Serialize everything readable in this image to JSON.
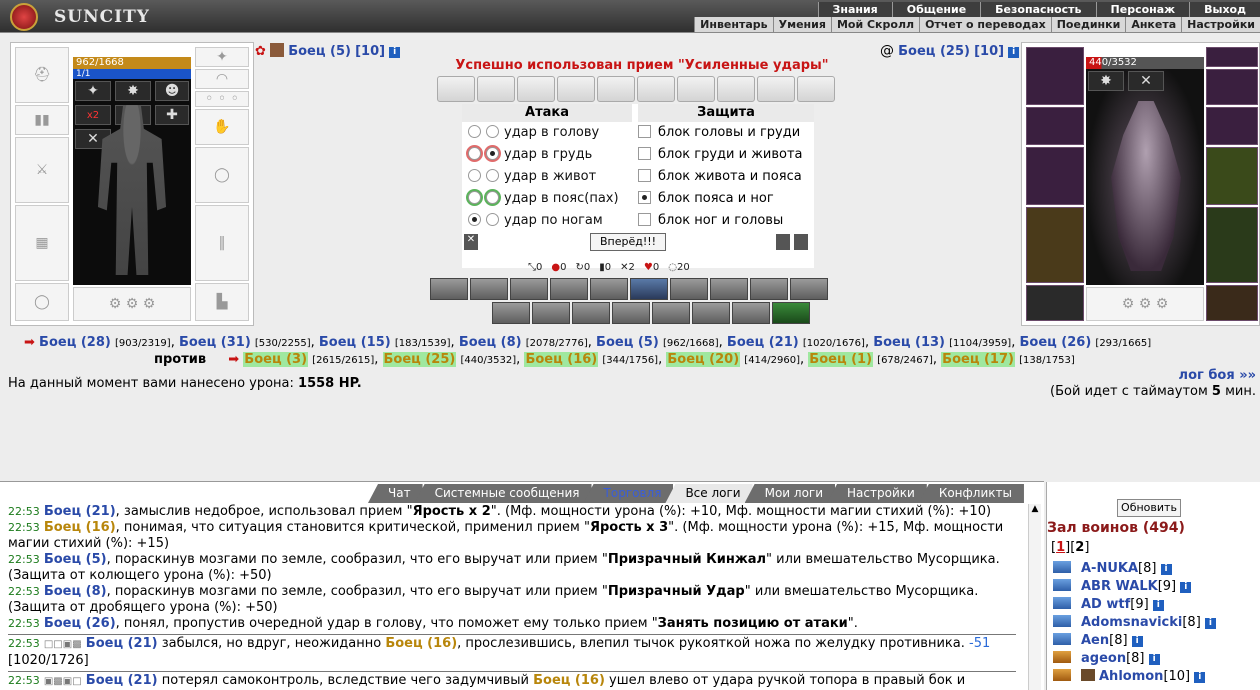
{
  "app": {
    "name": "SUNCITY"
  },
  "menu_top": [
    "Знания",
    "Общение",
    "Безопасность",
    "Персонаж",
    "Выход"
  ],
  "menu_sub": [
    "Инвентарь",
    "Умения",
    "Мой Скролл",
    "Отчет о переводах",
    "Поединки",
    "Анкета",
    "Настройки"
  ],
  "left_fighter": {
    "name": "Боец (5)",
    "level": "[10]",
    "hp": "962/1668",
    "mana": "1/1",
    "badge": "x2"
  },
  "right_fighter": {
    "name": "Боец (25)",
    "level": "[10]",
    "hp": "440/3532"
  },
  "info_icon": "i",
  "success": "Успешно использован прием \"Усиленные удары\"",
  "attack": {
    "title": "Атака",
    "rows": [
      "удар в голову",
      "удар в грудь",
      "удар в живот",
      "удар в пояс(пах)",
      "удар по ногам"
    ]
  },
  "defense": {
    "title": "Защита",
    "rows": [
      "блок головы и груди",
      "блок груди и живота",
      "блок живота и пояса",
      "блок пояса и ног",
      "блок ног и головы"
    ]
  },
  "forward_button": "Вперёд!!!",
  "stats": [
    "0",
    "0",
    "0",
    "0",
    "2",
    "0",
    "20"
  ],
  "team1": [
    {
      "name": "Боец (28)",
      "hp": "[903/2319]"
    },
    {
      "name": "Боец (31)",
      "hp": "[530/2255]"
    },
    {
      "name": "Боец (15)",
      "hp": "[183/1539]"
    },
    {
      "name": "Боец (8)",
      "hp": "[2078/2776]"
    },
    {
      "name": "Боец (5)",
      "hp": "[962/1668]"
    },
    {
      "name": "Боец (21)",
      "hp": "[1020/1676]"
    },
    {
      "name": "Боец (13)",
      "hp": "[1104/3959]"
    },
    {
      "name": "Боец (26)",
      "hp": "[293/1665]"
    }
  ],
  "vs_label": "против",
  "team2": [
    {
      "name": "Боец (3)",
      "hp": "[2615/2615]"
    },
    {
      "name": "Боец (25)",
      "hp": "[440/3532]"
    },
    {
      "name": "Боец (16)",
      "hp": "[344/1756]"
    },
    {
      "name": "Боец (20)",
      "hp": "[414/2960]"
    },
    {
      "name": "Боец (1)",
      "hp": "[678/2467]"
    },
    {
      "name": "Боец (17)",
      "hp": "[138/1753]"
    }
  ],
  "damage_text": "На данный момент вами нанесено урона:",
  "damage_value": "1558 HP.",
  "battle_log_link": "лог боя »»",
  "timeout_text": "(Бой идет с таймаутом",
  "timeout_value": "5",
  "timeout_unit": "мин.",
  "tabs": [
    "Чат",
    "Системные сообщения",
    "Торговля",
    "Все логи",
    "Мои логи",
    "Настройки",
    "Конфликты"
  ],
  "log": [
    {
      "t": "22:53",
      "a": "Боец (21)",
      "text": ", замыслив недоброе, использовал прием ",
      "bold": "Ярость x 2",
      "rest": ". (Мф. мощности урона (%): +10, Мф. мощности магии стихий (%): +10)"
    },
    {
      "t": "22:53",
      "a": "Боец (16)",
      "text": ", понимая, что ситуация становится критической, применил прием ",
      "bold": "Ярость x 3",
      "rest": ". (Мф. мощности урона (%): +15, Мф. мощности магии стихий (%): +15)"
    },
    {
      "t": "22:53",
      "a": "Боец (5)",
      "text": ", пораскинув мозгами по земле, сообразил, что его выручат или прием ",
      "bold": "Призрачный Кинжал",
      "rest": " или вмешательство Мусорщика. (Защита от колющего урона (%): +50)"
    },
    {
      "t": "22:53",
      "a": "Боец (8)",
      "text": ", пораскинув мозгами по земле, сообразил, что его выручат или прием ",
      "bold": "Призрачный Удар",
      "rest": " или вмешательство Мусорщика. (Защита от дробящего урона (%): +50)"
    },
    {
      "t": "22:53",
      "a": "Боец (26)",
      "text": ", понял, пропустив очередной удар в голову, что поможет ему только прием ",
      "bold": "Занять позицию от атаки",
      "rest": "."
    }
  ],
  "log2": {
    "t": "22:53",
    "a": "Боец (21)",
    "text": " забылся, но вдруг, неожиданно ",
    "b": "Боец (16)",
    "rest": ", прослезившись, влепил тычок рукояткой ножа по желудку противника.",
    "dmg": "-51",
    "hp": "[1020/1726]"
  },
  "log3": {
    "t": "22:53",
    "a": "Боец (21)",
    "text": " потерял самоконтроль, вследствие чего задумчивый ",
    "b": "Боец (16)",
    "rest": " ушел влево от удара ручкой топора в правый бок и"
  },
  "side": {
    "refresh": "Обновить",
    "hall": "Зал воинов (494)",
    "page1": "1",
    "page2": "2",
    "users": [
      {
        "name": "A-NUKA",
        "lvl": "[8]"
      },
      {
        "name": "ABR WALK",
        "lvl": "[9]"
      },
      {
        "name": "AD wtf",
        "lvl": "[9]"
      },
      {
        "name": "Adomsnavicki",
        "lvl": "[8]"
      },
      {
        "name": "Aen",
        "lvl": "[8]"
      },
      {
        "name": "ageon",
        "lvl": "[8]"
      },
      {
        "name": "Ahlomon",
        "lvl": "[10]"
      }
    ]
  }
}
